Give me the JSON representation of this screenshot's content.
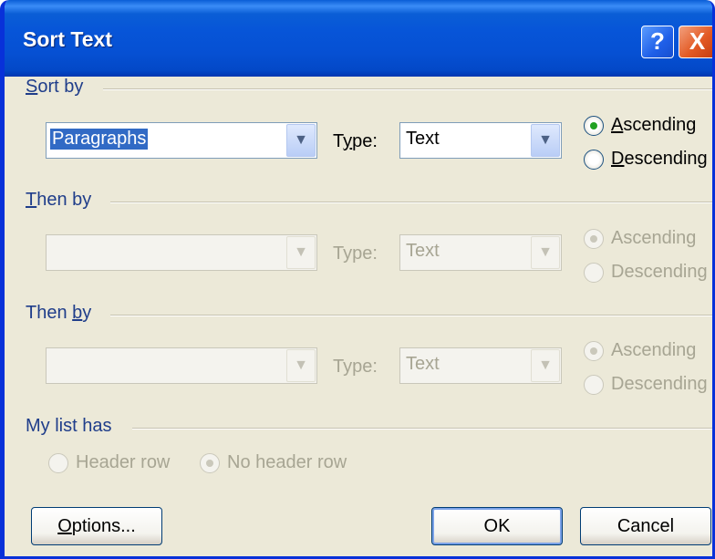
{
  "dialog": {
    "title": "Sort Text",
    "help_glyph": "?",
    "close_glyph": "X"
  },
  "sections": {
    "sort_by": {
      "label_accel": "S",
      "label_rest": "ort by",
      "field_value": "Paragraphs",
      "type_label_a": "T",
      "type_label_accel": "y",
      "type_label_b": "pe:",
      "type_value": "Text",
      "ascending_accel": "A",
      "ascending_rest": "scending",
      "descending_accel": "D",
      "descending_rest": "escending",
      "selected_order": "ascending"
    },
    "then_by_1": {
      "label_accel": "T",
      "label_rest": "hen by",
      "field_value": "",
      "type_label": "Type:",
      "type_value": "Text",
      "ascending": "Ascending",
      "descending": "Descending"
    },
    "then_by_2": {
      "label_a": "Then ",
      "label_accel": "b",
      "label_b": "y",
      "field_value": "",
      "type_label": "Type:",
      "type_value": "Text",
      "ascending": "Ascending",
      "descending": "Descending"
    },
    "my_list_has": {
      "label": "My list has",
      "header_row": "Header row",
      "no_header_row": "No header row",
      "selected": "no_header_row"
    }
  },
  "buttons": {
    "options_accel": "O",
    "options_rest": "ptions...",
    "ok": "OK",
    "cancel": "Cancel"
  },
  "colors": {
    "title_bar": "#0a5ed6",
    "dialog_bg": "#ece9d8",
    "selection": "#316ac5",
    "radio_dot": "#21a121"
  },
  "icons": {
    "dropdown": "chevron-down-icon",
    "help": "help-icon",
    "close": "close-icon"
  }
}
